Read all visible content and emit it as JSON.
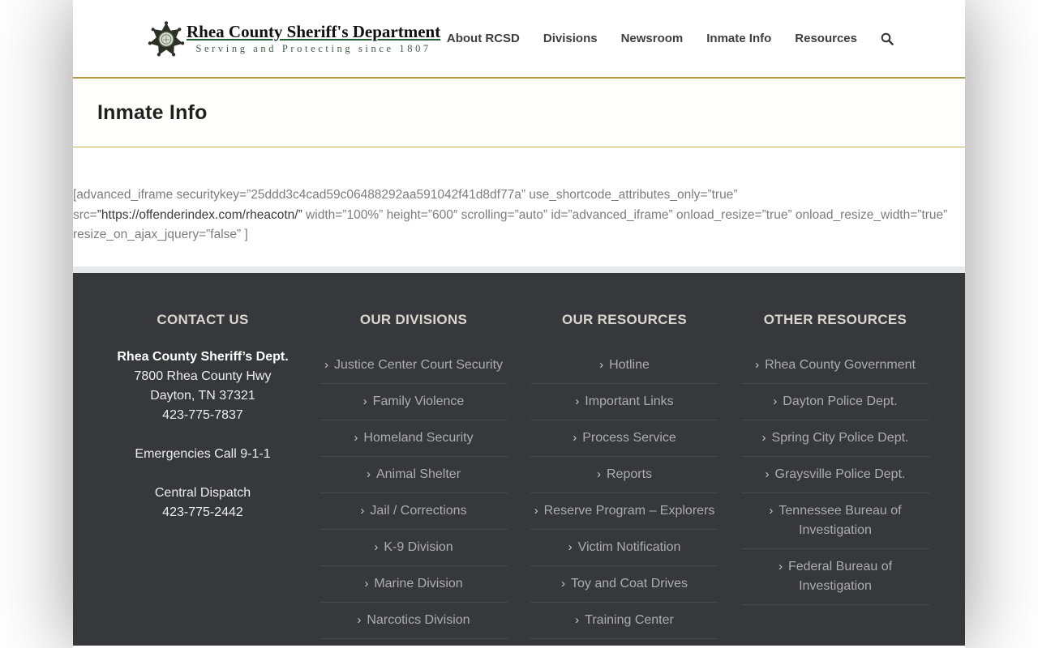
{
  "header": {
    "logo": {
      "title": "Rhea County Sheriff's Department",
      "tagline": "Serving and Protecting since 1807",
      "badge_icon": "sheriff-star-badge"
    },
    "nav": [
      "About RCSD",
      "Divisions",
      "Newsroom",
      "Inmate Info",
      "Resources"
    ],
    "search_icon": "search-icon"
  },
  "page_title": "Inmate Info",
  "content": {
    "shortcode_prefix": "[advanced_iframe securitykey=”25ddd3c4cad59c06488292aa591042f41d8df77a” use_shortcode_attributes_only=”true” src=",
    "shortcode_url": "”https://offenderindex.com/rheacotn/”",
    "shortcode_suffix": " width=”100%” height=”600″ scrolling=”auto” id=”advanced_iframe” onload_resize=”true” onload_resize_width=”true” resize_on_ajax_jquery=”false” ]"
  },
  "footer": {
    "contact": {
      "heading": "CONTACT US",
      "groups": [
        [
          "Rhea County Sheriff’s Dept.",
          "7800 Rhea County Hwy",
          "Dayton, TN 37321",
          "423-775-7837"
        ],
        [
          "Emergencies Call 9-1-1"
        ],
        [
          "Central Dispatch",
          "423-775-2442"
        ]
      ]
    },
    "link_columns": [
      {
        "heading": "OUR DIVISIONS",
        "links": [
          "Justice Center Court Security",
          "Family Violence",
          "Homeland Security",
          "Animal Shelter",
          "Jail / Corrections",
          "K-9 Division",
          "Marine Division",
          "Narcotics Division"
        ]
      },
      {
        "heading": "OUR RESOURCES",
        "links": [
          "Hotline",
          "Important Links",
          "Process Service",
          "Reports",
          "Reserve Program – Explorers",
          "Victim Notification",
          "Toy and Coat Drives",
          "Training Center"
        ]
      },
      {
        "heading": "OTHER RESOURCES",
        "links": [
          "Rhea County Government",
          "Dayton Police Dept.",
          "Spring City Police Dept.",
          "Graysville Police Dept.",
          "Tennessee Bureau of Investigation",
          "Federal Bureau of Investigation"
        ]
      }
    ]
  },
  "colors": {
    "gold_rule": "#b29a43",
    "footer_bg": "#36383b",
    "logo_green": "#1f5c33",
    "body_text_gray": "#7d7d7d"
  }
}
